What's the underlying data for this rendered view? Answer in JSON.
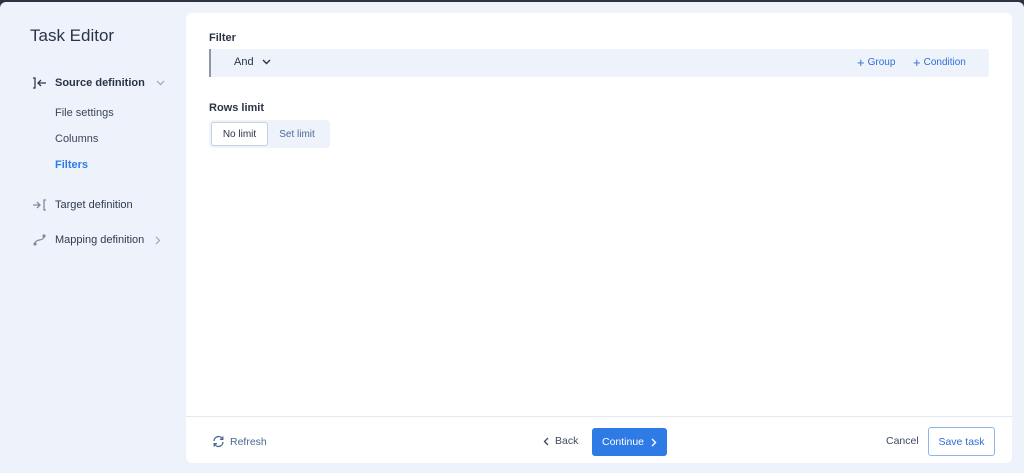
{
  "sidebar": {
    "title": "Task Editor",
    "items": [
      {
        "label": "Source definition",
        "icon": "source-definition-icon"
      },
      {
        "label": "Target definition",
        "icon": "target-definition-icon"
      },
      {
        "label": "Mapping definition",
        "icon": "mapping-definition-icon"
      }
    ],
    "source_children": [
      {
        "label": "File settings"
      },
      {
        "label": "Columns"
      },
      {
        "label": "Filters"
      }
    ]
  },
  "filter": {
    "label": "Filter",
    "operator": "And",
    "add_group": "Group",
    "add_condition": "Condition"
  },
  "rows_limit": {
    "label": "Rows limit",
    "options": [
      "No limit",
      "Set limit"
    ],
    "selected": "No limit"
  },
  "footer": {
    "refresh": "Refresh",
    "back": "Back",
    "continue": "Continue",
    "cancel": "Cancel",
    "save": "Save task"
  },
  "colors": {
    "accent": "#2f7be6",
    "sidebar_bg": "#edf2fb",
    "active_item": "#2f7be6"
  }
}
